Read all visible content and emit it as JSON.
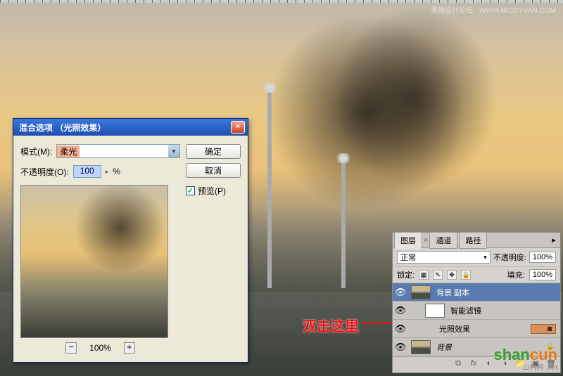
{
  "watermark_top": "思缘设计论坛 - WWW.MISSYUAN.COM",
  "watermark_bottom": {
    "text_green": "shan",
    "text_orange": "cun",
    "sub": "山村网 .net"
  },
  "dialog": {
    "title": "混合选项 （光照效果）",
    "mode_label": "模式(M):",
    "mode_value": "柔光",
    "opacity_label": "不透明度(O):",
    "opacity_value": "100",
    "opacity_suffix": "%",
    "ok": "确定",
    "cancel": "取消",
    "preview_label": "预览(P)",
    "zoom_level": "100%"
  },
  "annotation": "双击这里",
  "layers": {
    "tab_layers": "图层",
    "tab_channels": "通道",
    "tab_paths": "路径",
    "blend_mode": "正常",
    "opacity_label": "不透明度:",
    "opacity_value": "100%",
    "lock_label": "锁定:",
    "fill_label": "填充:",
    "fill_value": "100%",
    "items": [
      {
        "name": "背景 副本"
      },
      {
        "name": "智能滤镜"
      },
      {
        "name": "光照效果"
      },
      {
        "name": "背景"
      }
    ]
  },
  "icons": {
    "eye": "👁",
    "close_x": "×",
    "dropdown": "▾",
    "spinner": "▸",
    "minus": "−",
    "plus": "+",
    "check": "✓",
    "lock": "🔒",
    "link": "⧉",
    "fx": "fx",
    "mask": "◐",
    "folder": "📁",
    "adjust": "◑",
    "newlayer": "▣",
    "trash": "🗑",
    "menu": "▸≡"
  }
}
